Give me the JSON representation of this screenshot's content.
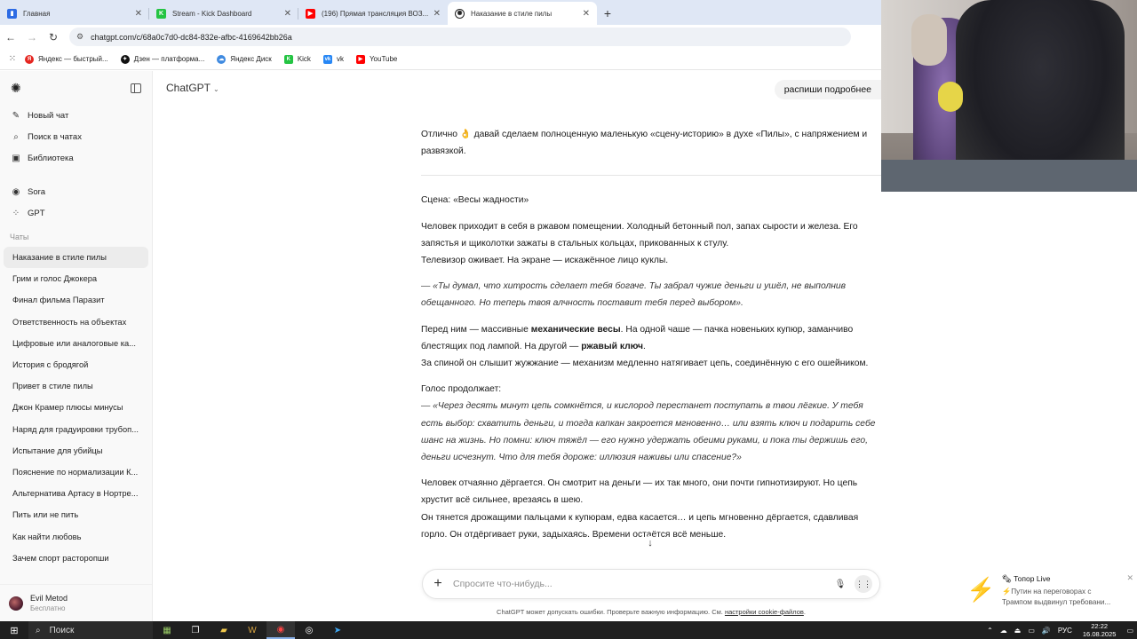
{
  "browser": {
    "tabs": [
      {
        "label": "Главная",
        "icon": "youtube-studio-icon",
        "color": "#2d6be4",
        "active": false
      },
      {
        "label": "Stream - Kick Dashboard",
        "icon": "kick-icon",
        "color": "#24c443",
        "active": false
      },
      {
        "label": "(196) Прямая трансляция ВОЗ...",
        "icon": "youtube-icon",
        "color": "#ff0000",
        "active": false
      },
      {
        "label": "Наказание в стиле пилы",
        "icon": "chatgpt-icon",
        "color": "#222222",
        "active": true
      }
    ],
    "url": "chatgpt.com/c/68a0c7d0-dc84-832e-afbc-4169642bb26a",
    "bookmarks": [
      {
        "label": "Яндекс — быстрый...",
        "color": "#e52620"
      },
      {
        "label": "Дзен — платформа...",
        "color": "#111111"
      },
      {
        "label": "Яндекс Диск",
        "color": "#3f8ae0"
      },
      {
        "label": "Kick",
        "color": "#24c443"
      },
      {
        "label": "vk",
        "color": "#2787f5"
      },
      {
        "label": "YouTube",
        "color": "#ff0000"
      }
    ]
  },
  "sidebar": {
    "nav": [
      {
        "label": "Новый чат",
        "icon": "new-chat-icon",
        "glyph": "✎"
      },
      {
        "label": "Поиск в чатах",
        "icon": "search-icon",
        "glyph": "⌕"
      },
      {
        "label": "Библиотека",
        "icon": "library-icon",
        "glyph": "▣"
      }
    ],
    "extras": [
      {
        "label": "Sora",
        "icon": "sora-icon",
        "glyph": "◉"
      },
      {
        "label": "GPT",
        "icon": "gpt-grid-icon",
        "glyph": "⁘"
      }
    ],
    "section_title": "Чаты",
    "chats": [
      "Наказание в стиле пилы",
      "Грим и голос Джокера",
      "Финал фильма Паразит",
      "Ответственность на объектах",
      "Цифровые или аналоговые ка...",
      "История с бродягой",
      "Привет в стиле пилы",
      "Джон Крамер плюсы минусы",
      "Наряд для градуировки трубоп...",
      "Испытание для убийцы",
      "Пояснение по нормализации К...",
      "Альтернатива Артасу в Нортре...",
      "Пить или не пить",
      "Как найти любовь",
      "Зачем спорт расторопши"
    ],
    "user": {
      "name": "Evil Metod",
      "plan": "Бесплатно"
    }
  },
  "main": {
    "model_label": "ChatGPT",
    "user_message": "распиши подробнее",
    "intro": "Отлично 👌 давай сделаем полноценную маленькую «сцену-историю» в духе «Пилы», с напряжением и развязкой.",
    "scene_title": "Сцена: «Весы жадности»",
    "p1": "Человек приходит в себя в ржавом помещении. Холодный бетонный пол, запах сырости и железа. Его запястья и щиколотки зажаты в стальных кольцах, прикованных к стулу.",
    "p1b": "Телевизор оживает. На экране — искажённое лицо куклы.",
    "quote1": "— «Ты думал, что хитрость сделает тебя богаче. Ты забрал чужие деньги и ушёл, не выполнив обещанного. Но теперь твоя алчность поставит тебя перед выбором».",
    "p2a": "Перед ним — массивные ",
    "p2b": "механические весы",
    "p2c": ". На одной чаше — пачка новеньких купюр, заманчиво блестящих под лампой. На другой — ",
    "p2d": "ржавый ключ",
    "p2e": ".",
    "p3": "За спиной он слышит жужжание — механизм медленно натягивает цепь, соединённую с его ошейником.",
    "p4": "Голос продолжает:",
    "quote2": "— «Через десять минут цепь сомкнётся, и кислород перестанет поступать в твои лёгкие. У тебя есть выбор: схватить деньги, и тогда капкан закроется мгновенно… или взять ключ и подарить себе шанс на жизнь. Но помни: ключ тяжёл — его нужно удержать обеими руками, и пока ты держишь его, деньги исчезнут. Что для тебя дороже: иллюзия наживы или спасение?»",
    "p5": "Человек отчаянно дёргается. Он смотрит на деньги — их так много, они почти гипнотизируют. Но цепь хрустит всё сильнее, врезаясь в шею.",
    "p6": "Он тянется дрожащими пальцами к купюрам, едва касается… и цепь мгновенно дёргается, сдавливая горло. Он отдёргивает руки, задыхаясь. Времени остаётся всё меньше.",
    "composer_placeholder": "Спросите что-нибудь...",
    "disclaimer": "ChatGPT может допускать ошибки. Проверьте важную информацию. См. ",
    "disclaimer_link": "настройки cookie-файлов",
    "disclaimer_end": "."
  },
  "notification": {
    "title": "🗞 Топор Live",
    "line1": "⚡Путин на переговорах с",
    "line2": "Трампом выдвинул требовани..."
  },
  "taskbar": {
    "search_label": "Поиск",
    "lang": "РУС",
    "time": "22:22",
    "date": "16.08.2025"
  }
}
